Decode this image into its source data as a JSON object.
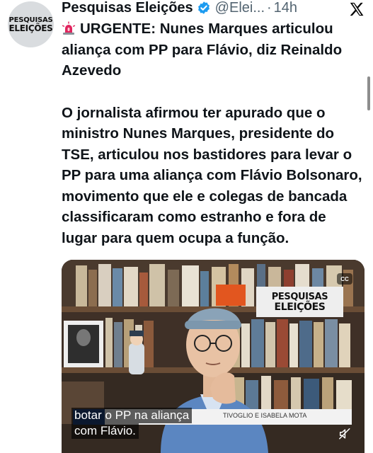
{
  "author": {
    "avatar_line1": "PESQUISAS",
    "avatar_line2": "ELEIÇÕES",
    "name": "Pesquisas Eleições",
    "handle": "@Elei...",
    "separator": "·",
    "time": "14h",
    "verified_icon": "verified-badge-icon"
  },
  "tweet": {
    "headline": "URGENTE: Nunes Marques articulou aliança com PP para Flávio, diz Reinaldo Azevedo",
    "body": "O jornalista afirmou ter apurado que o ministro Nunes Marques, presidente do TSE, articulou nos bastidores para levar o PP para uma aliança com Flávio Bolsonaro, movimento que ele e colegas de bancada classificaram como estranho e fora de lugar para quem ocupa a função."
  },
  "video": {
    "cc_label": "CC",
    "brand_line1": "PESQUISAS",
    "brand_line2": "ELEIÇÕES",
    "lower_third_names": "TIVOGLIO E ISABELA MOTA",
    "caption_line1": "botar o PP na aliança",
    "caption_line2": "com Flávio."
  },
  "colors": {
    "text": "#0f1419",
    "secondary": "#536471",
    "verified": "#1d9bf0",
    "siren": "#e0245e"
  }
}
